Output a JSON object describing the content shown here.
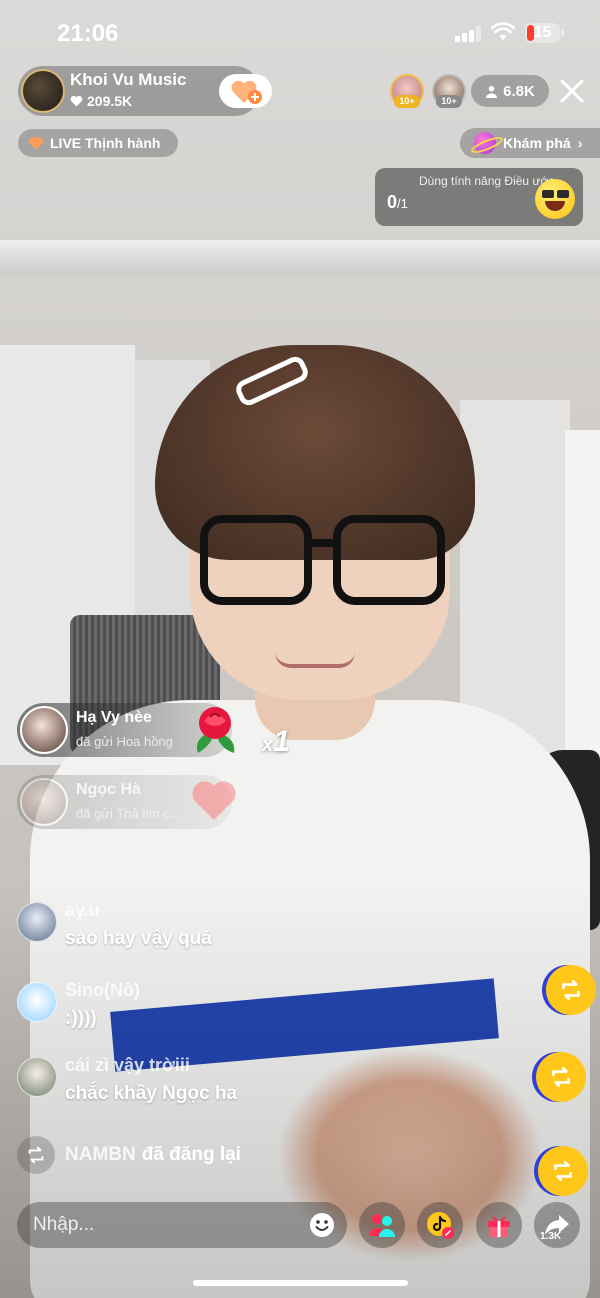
{
  "status_bar": {
    "time": "21:06",
    "battery": "15"
  },
  "host": {
    "name": "Khoi Vu Music",
    "likes": "209.5K"
  },
  "top_viewers": [
    {
      "badge": "10+"
    },
    {
      "badge": "10+"
    }
  ],
  "viewer_count": "6.8K",
  "trending_label": "LIVE Thịnh hành",
  "explore_label": "Khám phá",
  "challenge": {
    "title": "Dùng tính năng Điều ước",
    "count": "0",
    "total": "/1"
  },
  "gifts": [
    {
      "user": "Hạ Vy nèe",
      "action": "đã gửi Hoa hồng",
      "combo_prefix": "x",
      "combo_count": "1"
    },
    {
      "user": "Ngọc Hà",
      "action": "đã gửi Thả tim c..."
    }
  ],
  "chat": [
    {
      "user": "ay.u",
      "text": "sao hay vậy quá"
    },
    {
      "user": "Sino(Nô)",
      "text": ":))))"
    },
    {
      "user": "cái zì vậy trờiii",
      "text": "chắc khầy Ngọc ha"
    }
  ],
  "repost": {
    "user": "NAMBN",
    "text": "đã đăng lại"
  },
  "comment_placeholder": "Nhập...",
  "share_count": "1.3K",
  "colors": {
    "accent_pink": "#fe2c55",
    "repost_yellow": "#ffc71a",
    "follow_orange": "#ff8a3d"
  }
}
